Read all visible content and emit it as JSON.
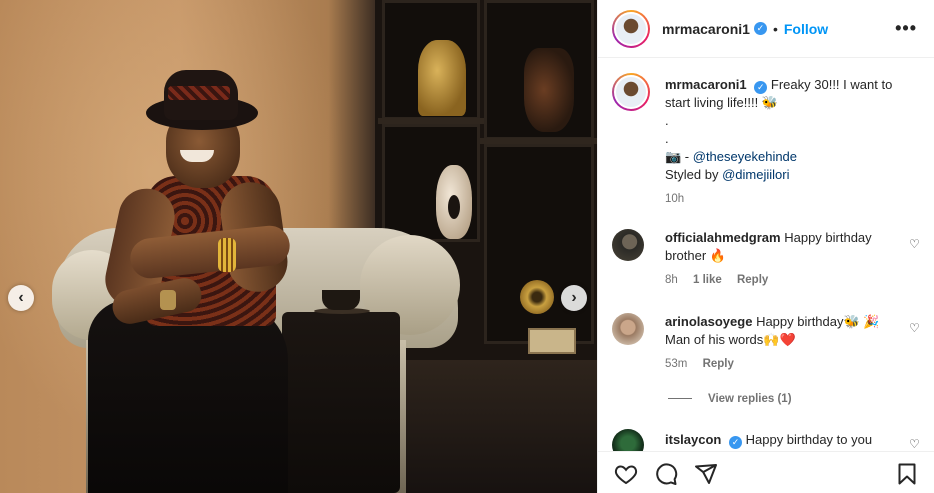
{
  "post": {
    "username": "mrmacaroni1",
    "verified": true,
    "follow_label": "Follow",
    "separator": "•",
    "more_label": "•••"
  },
  "caption": {
    "username": "mrmacaroni1",
    "text": "Freaky 30!!! I want to start living life!!!! 🐝",
    "dot1": ".",
    "dot2": ".",
    "photo_credit_prefix": "📷 - ",
    "photo_credit_handle": "@theseyekehinde",
    "styled_prefix": "Styled by ",
    "styled_handle": "@dimejiilori",
    "time": "10h"
  },
  "comments": [
    {
      "username": "officialahmedgram",
      "text": "Happy birthday brother 🔥",
      "time": "8h",
      "likes": "1 like",
      "reply": "Reply"
    },
    {
      "username": "arinolasoyege",
      "text": "Happy birthday🐝 🎉 Man of his words🙌❤️",
      "time": "53m",
      "reply": "Reply",
      "view_replies": "View replies (1)"
    },
    {
      "username": "itslaycon",
      "verified": true,
      "text": "Happy birthday to you"
    }
  ],
  "carousel": {
    "prev_icon": "‹",
    "next_icon": "›"
  },
  "icons": [
    "heart-icon",
    "comment-icon",
    "share-icon",
    "bookmark-icon",
    "more-icon",
    "verified-icon"
  ],
  "colors": {
    "accent": "#0095f6",
    "verified": "#3897f0",
    "text": "#262626",
    "muted": "#737373"
  }
}
